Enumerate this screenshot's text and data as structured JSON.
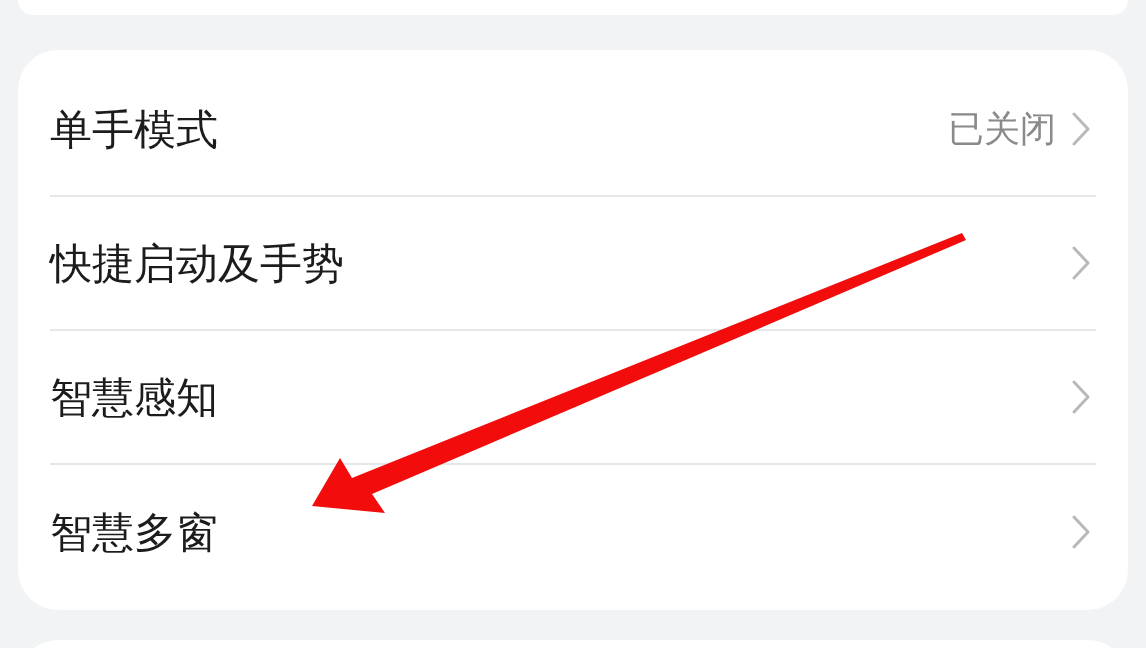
{
  "settings_list": [
    {
      "label": "单手模式",
      "value": "已关闭"
    },
    {
      "label": "快捷启动及手势"
    },
    {
      "label": "智慧感知"
    },
    {
      "label": "智慧多窗"
    }
  ]
}
